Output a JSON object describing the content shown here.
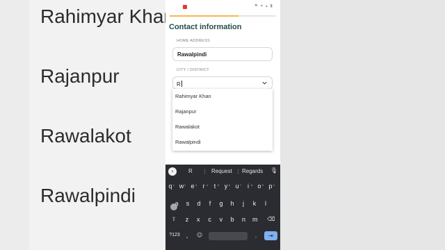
{
  "background": {
    "words": [
      "Rahimyar Khan",
      "Rajanpur",
      "Rawalakot",
      "Rawalpindi"
    ]
  },
  "status_bar": {
    "icons": "⚑ ▾ ▴ ▮"
  },
  "progress": {
    "fraction": 0.65
  },
  "form": {
    "title": "Contact information",
    "home_address_label": "HOME ADDRESS",
    "home_address_value": "Rawalpindi",
    "city_label": "CITY / DISTRICT",
    "city_value": "R"
  },
  "dropdown": {
    "options": [
      "Rahimyar Khan",
      "Rajanpur",
      "Rawalakot",
      "Rawalpindi"
    ]
  },
  "keyboard": {
    "suggestions": [
      "R",
      "Request",
      "Regards"
    ],
    "row1": [
      "q",
      "w",
      "e",
      "r",
      "t",
      "y",
      "u",
      "i",
      "o",
      "p"
    ],
    "row1_hints": [
      "1",
      "2",
      "3",
      "4",
      "5",
      "6",
      "7",
      "8",
      "9",
      "0"
    ],
    "row2": [
      "a",
      "s",
      "d",
      "f",
      "g",
      "h",
      "j",
      "k",
      "l"
    ],
    "row3": [
      "z",
      "x",
      "c",
      "v",
      "b",
      "n",
      "m"
    ],
    "symbols_label": "?123",
    "comma": ",",
    "period": "."
  },
  "colors": {
    "title": "#1f4d4a",
    "progress": "#f2b94e",
    "keyboard_bg": "#2a2c31",
    "enter_key": "#7fb1ee"
  }
}
